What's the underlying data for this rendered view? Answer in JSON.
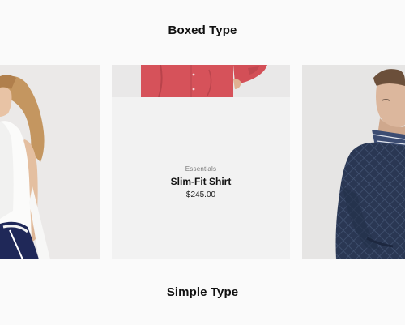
{
  "sections": {
    "boxed_title": "Boxed Type",
    "simple_title": "Simple Type"
  },
  "products": [
    {
      "image": "woman-white-vest-photo"
    },
    {
      "image": "red-shirt-photo",
      "category": "Essentials",
      "name": "Slim-Fit Shirt",
      "price": "$245.00"
    },
    {
      "image": "man-quilted-sweater-photo"
    }
  ],
  "colors": {
    "background": "#fafafa",
    "card_background": "#f2f2f2",
    "shirt_red": "#d9535a",
    "sweater_navy": "#27344f"
  }
}
